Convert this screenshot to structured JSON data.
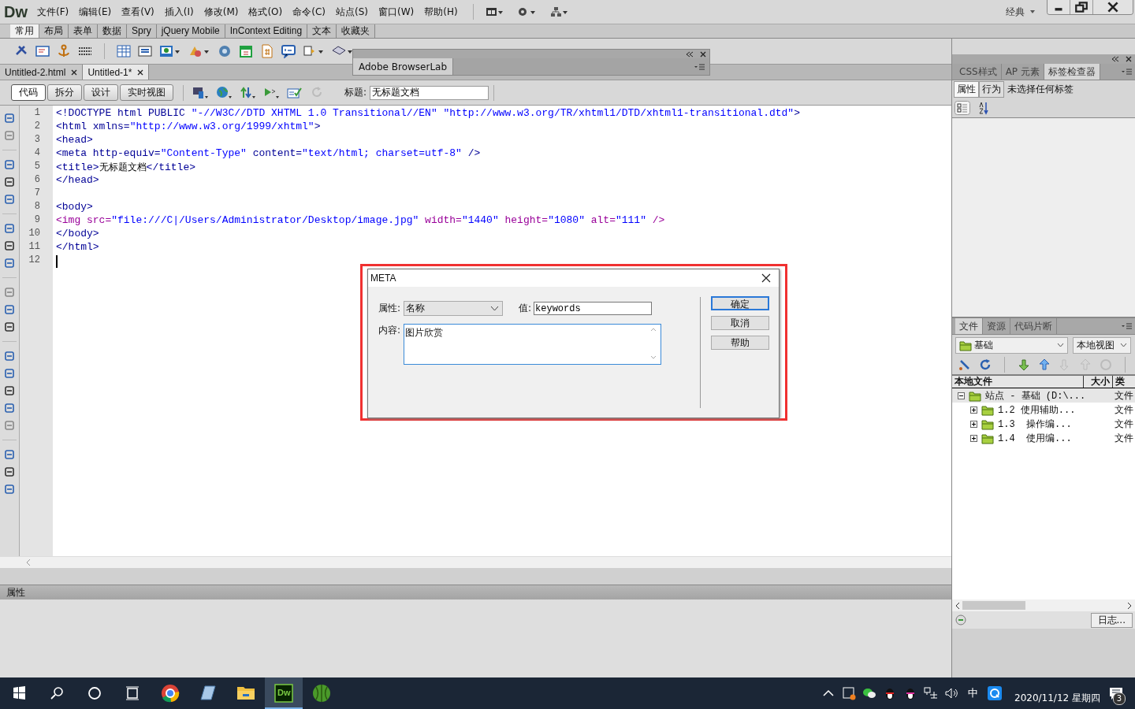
{
  "app": {
    "logo": "Dw",
    "menus": [
      "文件(F)",
      "编辑(E)",
      "查看(V)",
      "插入(I)",
      "修改(M)",
      "格式(O)",
      "命令(C)",
      "站点(S)",
      "窗口(W)",
      "帮助(H)"
    ],
    "workspace": "经典"
  },
  "insert_bar": {
    "tabs": [
      {
        "label": "常用",
        "selected": true
      },
      {
        "label": "布局",
        "selected": false
      },
      {
        "label": "表单",
        "selected": false
      },
      {
        "label": "数据",
        "selected": false
      },
      {
        "label": "Spry",
        "selected": false
      },
      {
        "label": "jQuery Mobile",
        "selected": false
      },
      {
        "label": "InContext Editing",
        "selected": false
      },
      {
        "label": "文本",
        "selected": false
      },
      {
        "label": "收藏夹",
        "selected": false
      }
    ]
  },
  "browserlab_panel": {
    "title": "Adobe BrowserLab"
  },
  "documents": [
    {
      "label": "Untitled-2.html",
      "selected": false
    },
    {
      "label": "Untitled-1*",
      "selected": true
    }
  ],
  "view_buttons": [
    {
      "label": "代码",
      "selected": true
    },
    {
      "label": "拆分",
      "selected": false
    },
    {
      "label": "设计",
      "selected": false
    },
    {
      "label": "实时视图",
      "selected": false
    }
  ],
  "title_field": {
    "label": "标题:",
    "value": "无标题文档"
  },
  "code": {
    "lines": [
      {
        "number": "1",
        "segments": [
          {
            "kind": "tag",
            "text": "<!DOCTYPE html PUBLIC "
          },
          {
            "kind": "value",
            "text": "\"-//W3C//DTD XHTML 1.0 Transitional//EN\" \"http://www.w3.org/TR/xhtml1/DTD/xhtml1-transitional.dtd\""
          },
          {
            "kind": "tag",
            "text": ">"
          }
        ]
      },
      {
        "number": "2",
        "segments": [
          {
            "kind": "tag",
            "text": "<html xmlns="
          },
          {
            "kind": "value",
            "text": "\"http://www.w3.org/1999/xhtml\""
          },
          {
            "kind": "tag",
            "text": ">"
          }
        ]
      },
      {
        "number": "3",
        "segments": [
          {
            "kind": "tag",
            "text": "<head>"
          }
        ]
      },
      {
        "number": "4",
        "segments": [
          {
            "kind": "tag",
            "text": "<meta http-equiv="
          },
          {
            "kind": "value",
            "text": "\"Content-Type\""
          },
          {
            "kind": "tag",
            "text": " content="
          },
          {
            "kind": "value",
            "text": "\"text/html; charset=utf-8\""
          },
          {
            "kind": "tag",
            "text": " />"
          }
        ]
      },
      {
        "number": "5",
        "segments": [
          {
            "kind": "tag",
            "text": "<title>"
          },
          {
            "kind": "text",
            "text": "无标题文档"
          },
          {
            "kind": "tag",
            "text": "</title>"
          }
        ]
      },
      {
        "number": "6",
        "segments": [
          {
            "kind": "tag",
            "text": "</head>"
          }
        ]
      },
      {
        "number": "7"
      },
      {
        "number": "8",
        "segments": [
          {
            "kind": "tag",
            "text": "<body>"
          }
        ]
      },
      {
        "number": "9",
        "segments": [
          {
            "kind": "media",
            "text": "<img src="
          },
          {
            "kind": "value",
            "text": "\"file:///C|/Users/Administrator/Desktop/image.jpg\""
          },
          {
            "kind": "media",
            "text": " width="
          },
          {
            "kind": "value",
            "text": "\"1440\""
          },
          {
            "kind": "media",
            "text": " height="
          },
          {
            "kind": "value",
            "text": "\"1080\""
          },
          {
            "kind": "media",
            "text": " alt="
          },
          {
            "kind": "value",
            "text": "\"111\""
          },
          {
            "kind": "media",
            "text": " />"
          }
        ]
      },
      {
        "number": "10",
        "segments": [
          {
            "kind": "tag",
            "text": "</body>"
          }
        ]
      },
      {
        "number": "11",
        "segments": [
          {
            "kind": "tag",
            "text": "</html>"
          }
        ]
      },
      {
        "number": "12"
      }
    ]
  },
  "properties_panel": {
    "title": "属性"
  },
  "tag_inspector": {
    "tabs": [
      {
        "label": "CSS样式",
        "selected": false
      },
      {
        "label": "AP 元素",
        "selected": false
      },
      {
        "label": "标签检查器",
        "selected": true
      }
    ],
    "mode_buttons": [
      {
        "label": "属性",
        "selected": true
      },
      {
        "label": "行为",
        "selected": false
      }
    ],
    "status": "未选择任何标签"
  },
  "files_panel": {
    "tabs": [
      {
        "label": "文件",
        "selected": true
      },
      {
        "label": "资源",
        "selected": false
      },
      {
        "label": "代码片断",
        "selected": false
      }
    ],
    "site": "基础",
    "view": "本地视图",
    "columns": [
      "本地文件",
      "大小",
      "类"
    ],
    "tree": [
      {
        "name": "站点 - 基础 (D:\\...",
        "type": "文件",
        "expanded": true,
        "children": [
          {
            "name": "1.2 使用辅助...",
            "type": "文件",
            "expanded": false
          },
          {
            "name": "1.3  操作编...",
            "type": "文件",
            "expanded": false
          },
          {
            "name": "1.4  使用编...",
            "type": "文件",
            "expanded": false
          }
        ]
      }
    ],
    "log_button": "日志..."
  },
  "dialog": {
    "highlighted": true,
    "title": "META",
    "attribute_label": "属性:",
    "attribute_value": "名称",
    "value_label": "值:",
    "value": "keywords",
    "content_label": "内容:",
    "content": "图片欣赏",
    "buttons": [
      {
        "label": "确定",
        "default": true
      },
      {
        "label": "取消",
        "default": false
      },
      {
        "label": "帮助",
        "default": false
      }
    ]
  },
  "taskbar": {
    "apps": [
      {
        "kind": "chrome",
        "active": false
      },
      {
        "kind": "notebook",
        "active": false
      },
      {
        "kind": "folder",
        "active": false
      },
      {
        "kind": "dreamweaver",
        "label": "Dw",
        "active": true
      },
      {
        "kind": "melon",
        "active": false
      }
    ],
    "ime": "中",
    "date": "2020/11/12 星期四",
    "notifications": "3"
  }
}
